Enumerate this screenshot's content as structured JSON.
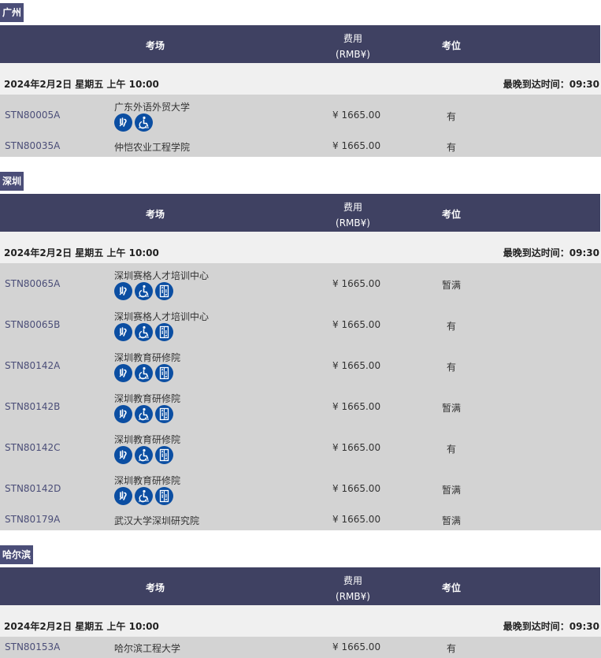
{
  "header": {
    "venue": "考场",
    "fee_line1": "费用",
    "fee_line2": "(RMB¥)",
    "seat": "考位"
  },
  "cities": [
    {
      "name": "广州",
      "date": "2024年2月2日 星期五 上午 10:00",
      "latest": "最晚到达时间：09:30",
      "rows": [
        {
          "code": "STN80005A",
          "venue": "广东外语外贸大学",
          "fee": "¥ 1665.00",
          "seat": "有",
          "icons": [
            "hearing-icon",
            "wheelchair-icon"
          ]
        },
        {
          "code": "STN80035A",
          "venue": "仲恺农业工程学院",
          "fee": "¥ 1665.00",
          "seat": "有",
          "icons": []
        }
      ]
    },
    {
      "name": "深圳",
      "date": "2024年2月2日 星期五 上午 10:00",
      "latest": "最晚到达时间：09:30",
      "rows": [
        {
          "code": "STN80065A",
          "venue": "深圳赛格人才培训中心",
          "fee": "¥ 1665.00",
          "seat": "暂满",
          "icons": [
            "hearing-icon",
            "wheelchair-icon",
            "elevator-icon"
          ]
        },
        {
          "code": "STN80065B",
          "venue": "深圳赛格人才培训中心",
          "fee": "¥ 1665.00",
          "seat": "有",
          "icons": [
            "hearing-icon",
            "wheelchair-icon",
            "elevator-icon"
          ]
        },
        {
          "code": "STN80142A",
          "venue": "深圳教育研修院",
          "fee": "¥ 1665.00",
          "seat": "有",
          "icons": [
            "hearing-icon",
            "wheelchair-icon",
            "elevator-icon"
          ]
        },
        {
          "code": "STN80142B",
          "venue": "深圳教育研修院",
          "fee": "¥ 1665.00",
          "seat": "暂满",
          "icons": [
            "hearing-icon",
            "wheelchair-icon",
            "elevator-icon"
          ]
        },
        {
          "code": "STN80142C",
          "venue": "深圳教育研修院",
          "fee": "¥ 1665.00",
          "seat": "有",
          "icons": [
            "hearing-icon",
            "wheelchair-icon",
            "elevator-icon"
          ]
        },
        {
          "code": "STN80142D",
          "venue": "深圳教育研修院",
          "fee": "¥ 1665.00",
          "seat": "暂满",
          "icons": [
            "hearing-icon",
            "wheelchair-icon",
            "elevator-icon"
          ]
        },
        {
          "code": "STN80179A",
          "venue": "武汉大学深圳研究院",
          "fee": "¥ 1665.00",
          "seat": "暂满",
          "icons": []
        }
      ]
    },
    {
      "name": "哈尔滨",
      "date": "2024年2月2日 星期五 上午 10:00",
      "latest": "最晚到达时间：09:30",
      "rows": [
        {
          "code": "STN80153A",
          "venue": "哈尔滨工程大学",
          "fee": "¥ 1665.00",
          "seat": "有",
          "icons": []
        }
      ]
    }
  ]
}
